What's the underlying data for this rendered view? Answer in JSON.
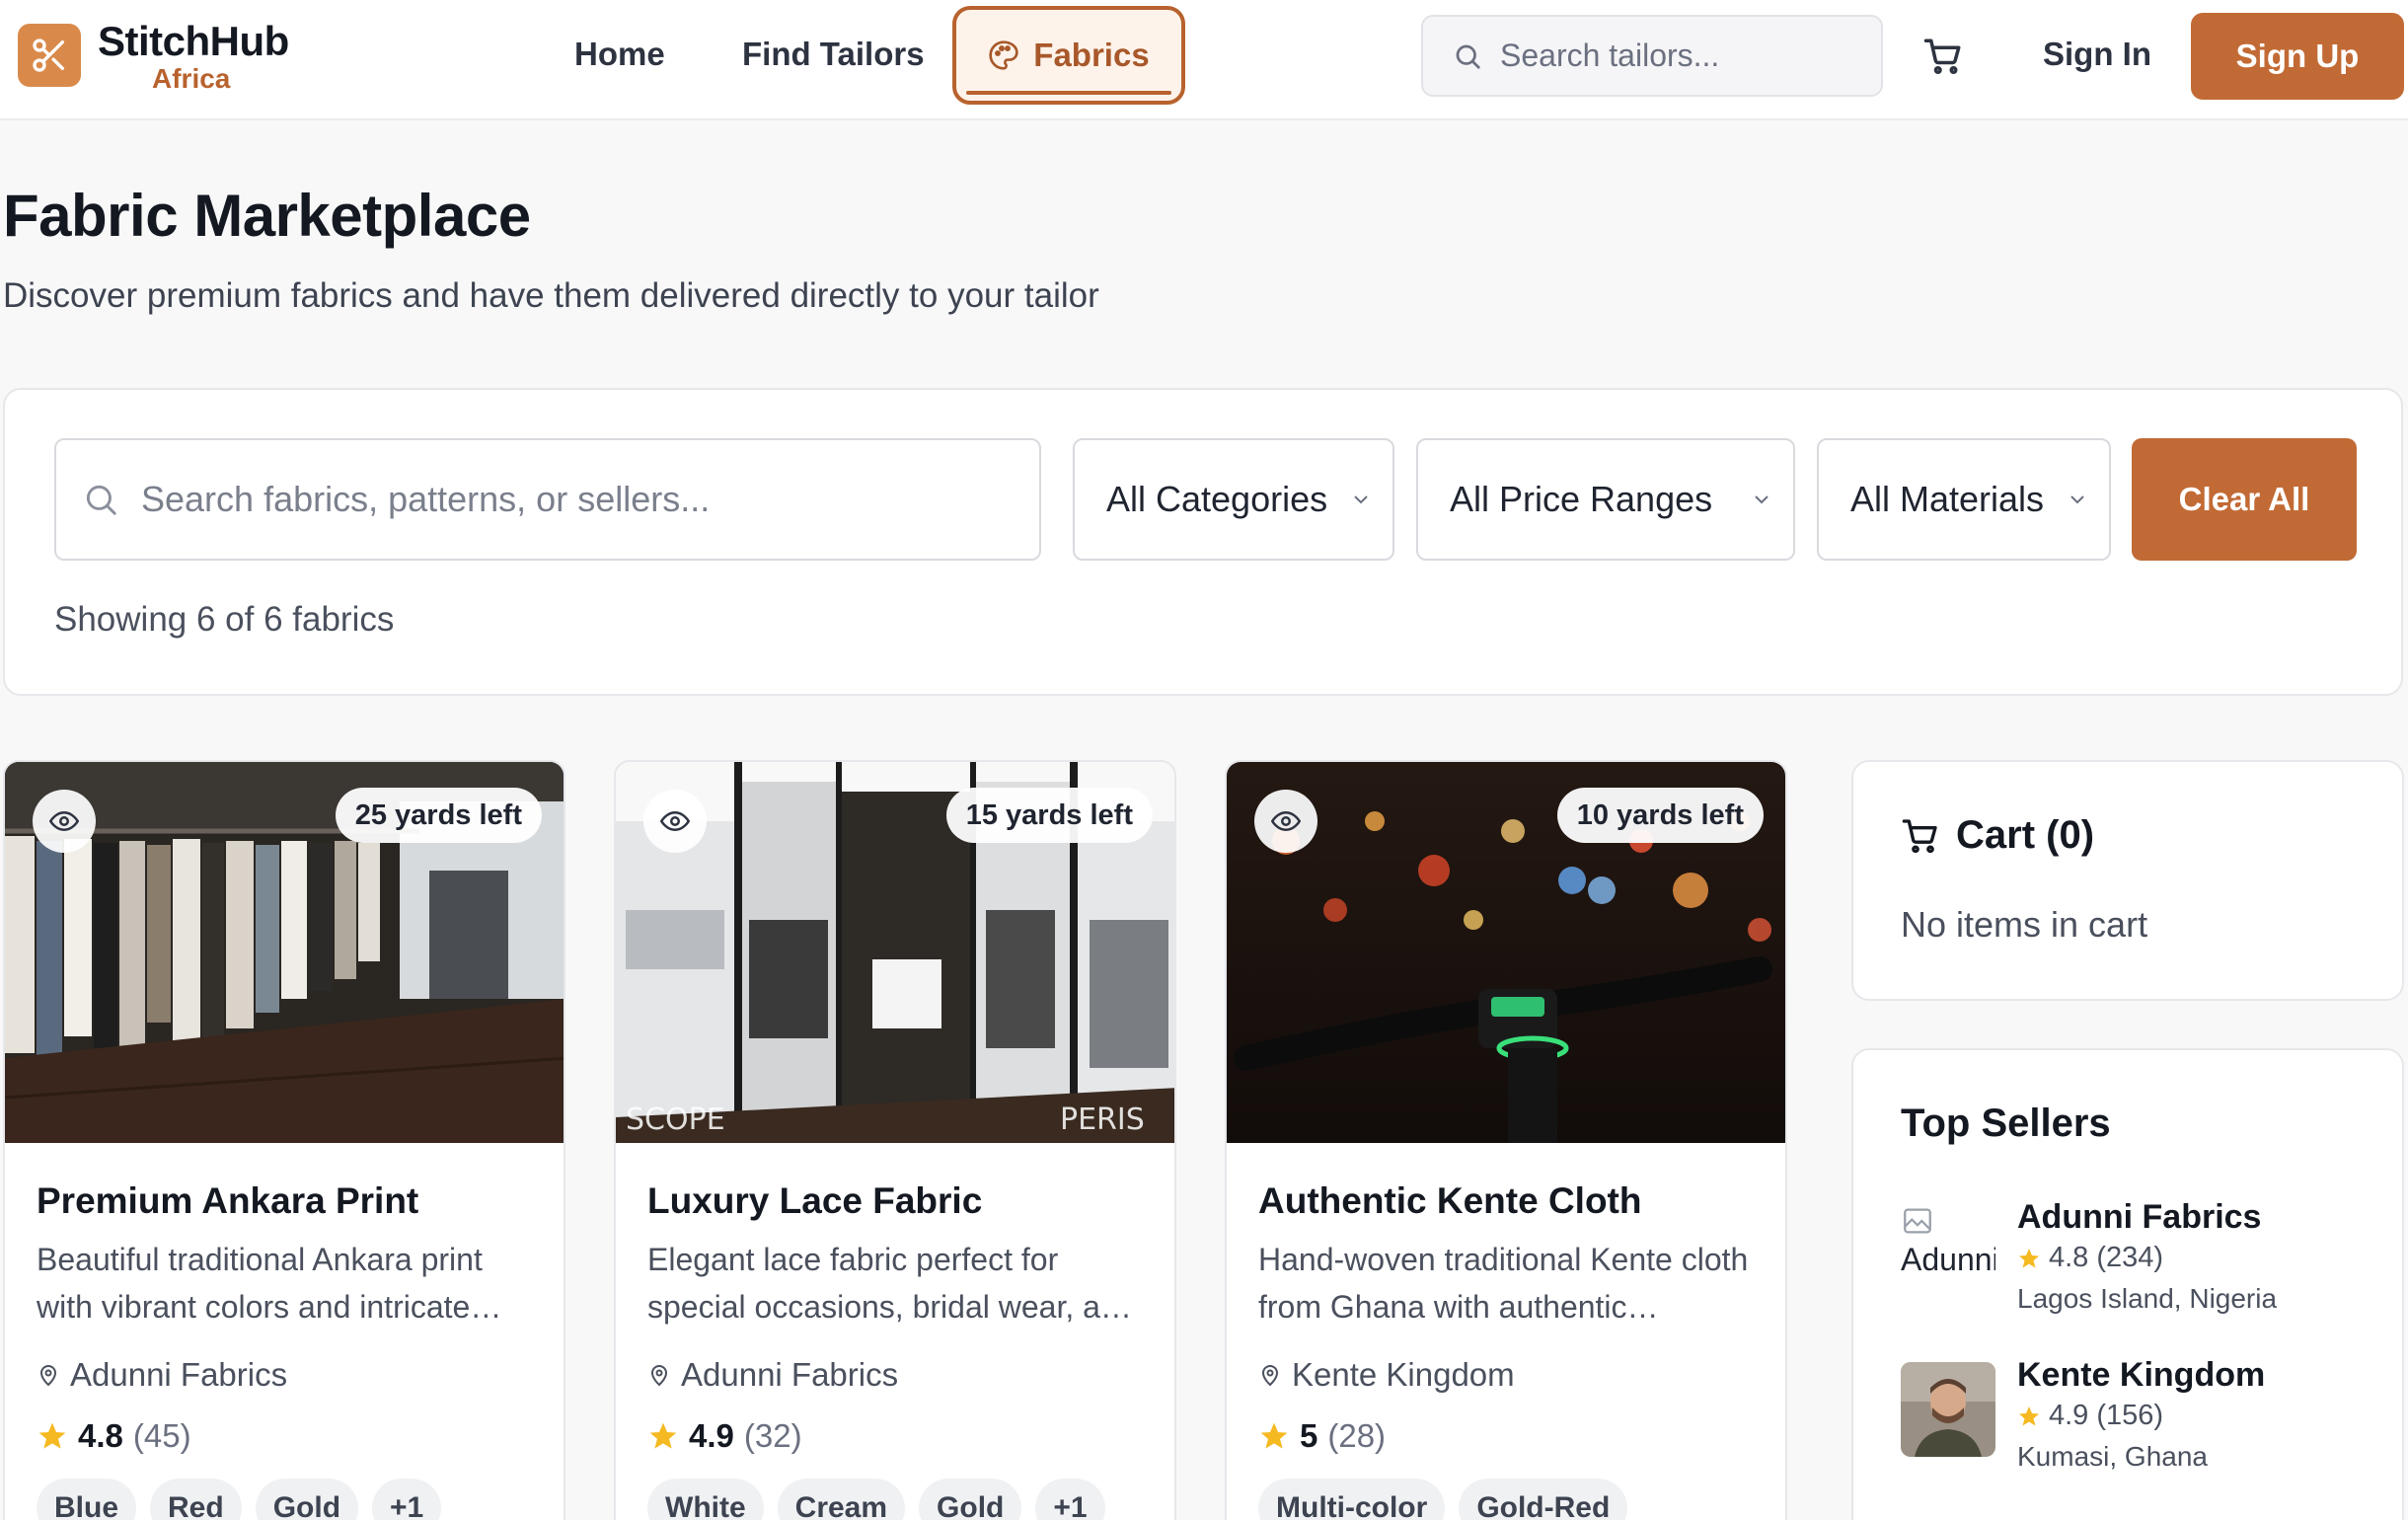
{
  "brand": {
    "name": "StitchHub",
    "sub": "Africa"
  },
  "nav": {
    "home": "Home",
    "find_tailors": "Find Tailors",
    "fabrics": "Fabrics"
  },
  "header": {
    "search_placeholder": "Search tailors...",
    "sign_in": "Sign In",
    "sign_up": "Sign Up"
  },
  "page": {
    "title": "Fabric Marketplace",
    "subtitle": "Discover premium fabrics and have them delivered directly to your tailor"
  },
  "filters": {
    "search_placeholder": "Search fabrics, patterns, or sellers...",
    "category": "All Categories",
    "price_range": "All Price Ranges",
    "material": "All Materials",
    "clear": "Clear All",
    "showing": "Showing 6 of 6 fabrics"
  },
  "fabrics": [
    {
      "name": "Premium Ankara Print",
      "description": "Beautiful traditional Ankara print with vibrant colors and intricate…",
      "seller": "Adunni Fabrics",
      "rating": "4.8",
      "reviews": "(45)",
      "stock": "25 yards left",
      "colors": [
        "Blue",
        "Red",
        "Gold",
        "+1"
      ]
    },
    {
      "name": "Luxury Lace Fabric",
      "description": "Elegant lace fabric perfect for special occasions, bridal wear, a…",
      "seller": "Adunni Fabrics",
      "rating": "4.9",
      "reviews": "(32)",
      "stock": "15 yards left",
      "colors": [
        "White",
        "Cream",
        "Gold",
        "+1"
      ]
    },
    {
      "name": "Authentic Kente Cloth",
      "description": "Hand-woven traditional Kente cloth from Ghana with authentic…",
      "seller": "Kente Kingdom",
      "rating": "5",
      "reviews": "(28)",
      "stock": "10 yards left",
      "colors": [
        "Multi-color",
        "Gold-Red"
      ]
    }
  ],
  "cart": {
    "title": "Cart (0)",
    "empty": "No items in cart"
  },
  "top_sellers": {
    "title": "Top Sellers",
    "items": [
      {
        "name": "Adunni Fabrics",
        "alt": "Adunni",
        "rating": "4.8 (234)",
        "location": "Lagos Island, Nigeria"
      },
      {
        "name": "Kente Kingdom",
        "rating": "4.9 (156)",
        "location": "Kumasi, Ghana"
      }
    ]
  },
  "colors": {
    "accent": "#c26a35",
    "accent_light": "#fdf3ea",
    "star": "#f5b921"
  },
  "icons": [
    "scissors-icon",
    "palette-icon",
    "search-icon",
    "cart-icon",
    "chevron-down-icon",
    "eye-icon",
    "map-pin-icon",
    "star-icon"
  ]
}
